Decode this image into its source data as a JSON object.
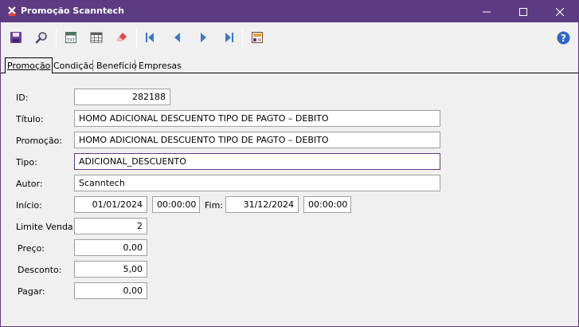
{
  "window": {
    "title": "Promoção Scanntech",
    "accent_color": "#5d3b83"
  },
  "toolbar": {
    "icons": [
      "save-icon",
      "search-icon",
      "export-txt-icon",
      "grid-icon",
      "eraser-icon",
      "first-record-icon",
      "previous-record-icon",
      "next-record-icon",
      "last-record-icon",
      "report-icon",
      "help-icon"
    ]
  },
  "tabs": [
    {
      "label": "Promoção",
      "active": true
    },
    {
      "label": "Condição",
      "active": false
    },
    {
      "label": "Benefício",
      "active": false
    },
    {
      "label": "Empresas",
      "active": false
    }
  ],
  "form": {
    "id_label": "ID:",
    "id_value": "282188",
    "titulo_label": "Título:",
    "titulo_value": "HOMO ADICIONAL DESCUENTO TIPO DE PAGTO – DEBITO",
    "promocao_label": "Promoção:",
    "promocao_value": "HOMO ADICIONAL DESCUENTO TIPO DE PAGTO – DEBITO",
    "tipo_label": "Tipo:",
    "tipo_value": "ADICIONAL_DESCUENTO",
    "autor_label": "Autor:",
    "autor_value": "Scanntech",
    "inicio_label": "Início:",
    "inicio_date": "01/01/2024",
    "inicio_time": "00:00:00",
    "fim_label": "Fim:",
    "fim_date": "31/12/2024",
    "fim_time": "00:00:00",
    "limite_label": "Limite Venda:",
    "limite_value": "2",
    "preco_label": "Preço:",
    "preco_value": "0,00",
    "desconto_label": "Desconto:",
    "desconto_value": "5,00",
    "pagar_label": "Pagar:",
    "pagar_value": "0,00"
  }
}
